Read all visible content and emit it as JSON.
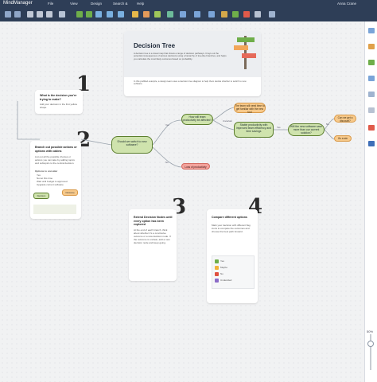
{
  "app": {
    "title": "MindManager",
    "user": "Anna Crane"
  },
  "menu": [
    "File",
    "View",
    "Design",
    "Search &",
    "Help"
  ],
  "zoom": "50%",
  "hero": {
    "title": "Decision Tree",
    "body": "A decision tree is a visual map that shows a range of decision pathways. It lays out the potential consequences of various decisions using a hierarchy of tree-like branches, and helps you calculate the most likely outcomes based on probability.",
    "caption": "In this prefilled example, a design team uses a decision tree diagram to help them decide whether to switch to new software."
  },
  "steps": [
    "1",
    "2",
    "3",
    "4"
  ],
  "card1": {
    "title": "What is the decision you're trying to make?",
    "text": "Add your decision in the first yellow shape."
  },
  "card2": {
    "title": "Branch out possible actions or options with cabins",
    "text": "List out all the possible choices or actions you can take by adding topics and subtopics to the central decision.",
    "sub": "Options to consider",
    "list": [
      "Yes",
      "Not at this time",
      "Wait until budget is approved",
      "Upgrade current software"
    ],
    "tag_decision": "Decision",
    "tag_outcome": "Outcome"
  },
  "card3": {
    "title": "Extend Decision Nodes until every option has been explored",
    "text": "At the end of each branch, think about whether it's a conclusive outcome or a new decision node. If the outcome is unclear, add a new decision node and keep going."
  },
  "card4": {
    "title": "Compare different options",
    "text": "Mark your decision with different flag icons to compare the outcomes and choose the best path forward.",
    "legend": [
      "Yes",
      "Maybe",
      "No",
      "Undecided"
    ]
  },
  "tree": {
    "root": "Should we switch to new software?",
    "a": "How will team productivity be affected?",
    "b": "Stable productivity with improved team efficiency and time savings",
    "c": "The team will need time to get familiar with the new tool",
    "d": "Will the new software save more than our current solution?",
    "e1": "Can we get a discount?",
    "e2": "It's a win",
    "f": "Loss of productivity",
    "labels": [
      "Yes",
      "Uncertain",
      "Yes",
      "No",
      "No"
    ]
  },
  "colors": {
    "chrome": "#2e3e57",
    "green": "#cfe3ad",
    "orange": "#f7c98a",
    "red": "#f3a39c"
  }
}
